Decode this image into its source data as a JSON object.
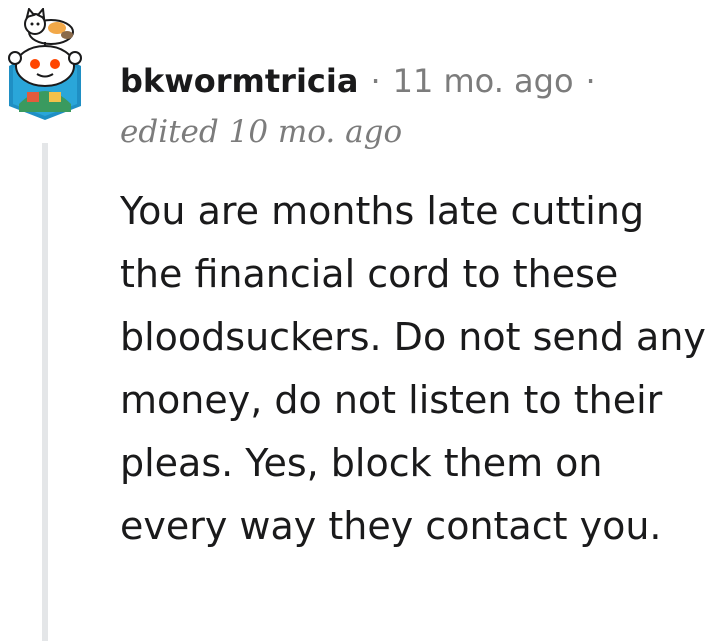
{
  "comment": {
    "username": "bkwormtricia",
    "separator": "·",
    "timestamp": "11 mo. ago",
    "edited": "edited 10 mo. ago",
    "body": "You are months late cutting the financial cord to these bloodsuckers. Do not send any money, do not listen to their pleas. Yes, block them on every way they contact you."
  },
  "avatar": {
    "icon": "snoo-avatar-with-cat-icon",
    "colors": {
      "hex_background": "#1f8fc4",
      "snoo_body": "#ffffff",
      "eye": "#ff4500",
      "outline": "#1a1a1b"
    }
  }
}
